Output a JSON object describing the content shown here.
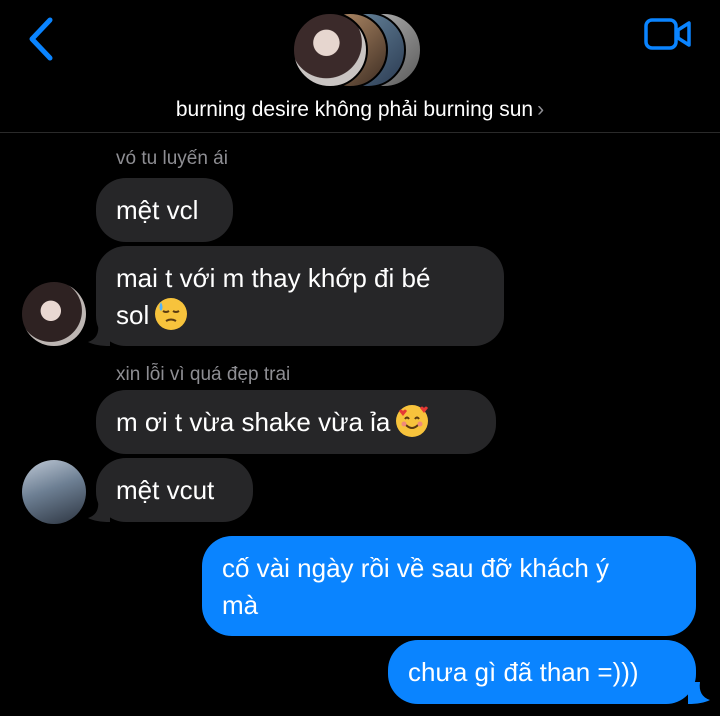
{
  "header": {
    "back_icon": "chevron-left-icon",
    "video_icon": "video-camera-icon",
    "group_name": "burning desire không phải burning sun",
    "chevron": "›",
    "accent": "#0a84ff"
  },
  "messages": [
    {
      "sender": "vó tu luyến ái"
    },
    {
      "text": "mệt vcl"
    },
    {
      "text": "mai t với m thay khớp đi bé",
      "text2": "sol",
      "emoji": "😓"
    },
    {
      "sender": "xin lỗi vì quá đẹp trai"
    },
    {
      "text": "m ơi t vừa shake vừa ỉa",
      "emoji": "🥰"
    },
    {
      "text": "mệt vcut"
    },
    {
      "text": "cố vài ngày rồi về sau đỡ khách ý",
      "text2": "mà"
    },
    {
      "text": "chưa gì đã than =)))"
    }
  ],
  "colors": {
    "incoming_bubble": "#262628",
    "outgoing_bubble": "#0a84ff",
    "sender_label": "#8e8e93"
  }
}
